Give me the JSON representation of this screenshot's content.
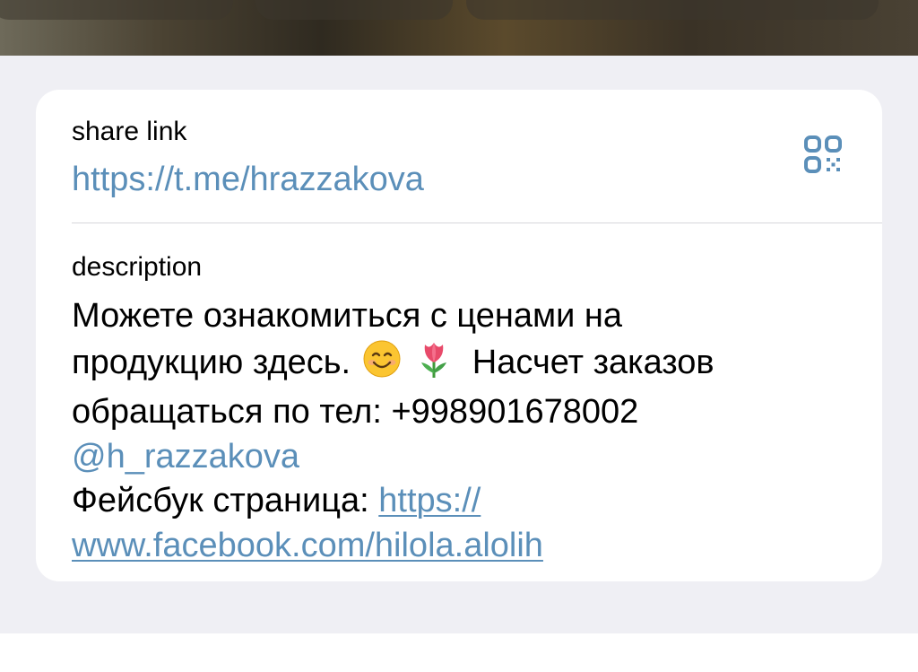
{
  "share_link": {
    "label": "share link",
    "url": "https://t.me/hrazzakova",
    "qr_icon": "qr-code-icon"
  },
  "description": {
    "label": "description",
    "line1": "Можете ознакомиться с ценами на",
    "line2_text": "продукцию здесь.",
    "emoji1": "smiling-face-icon",
    "emoji2": "tulip-icon",
    "line2_tail": "Насчет заказов",
    "line3": "обращаться по тел: +998901678002",
    "mention": "@h_razzakova",
    "fb_prefix": "Фейсбук страница: ",
    "fb_url_part1": "https://",
    "fb_url_part2": "www.facebook.com/hilola.alolih"
  },
  "colors": {
    "link": "#5b8fb9",
    "background": "#efeff4",
    "card": "#ffffff"
  }
}
